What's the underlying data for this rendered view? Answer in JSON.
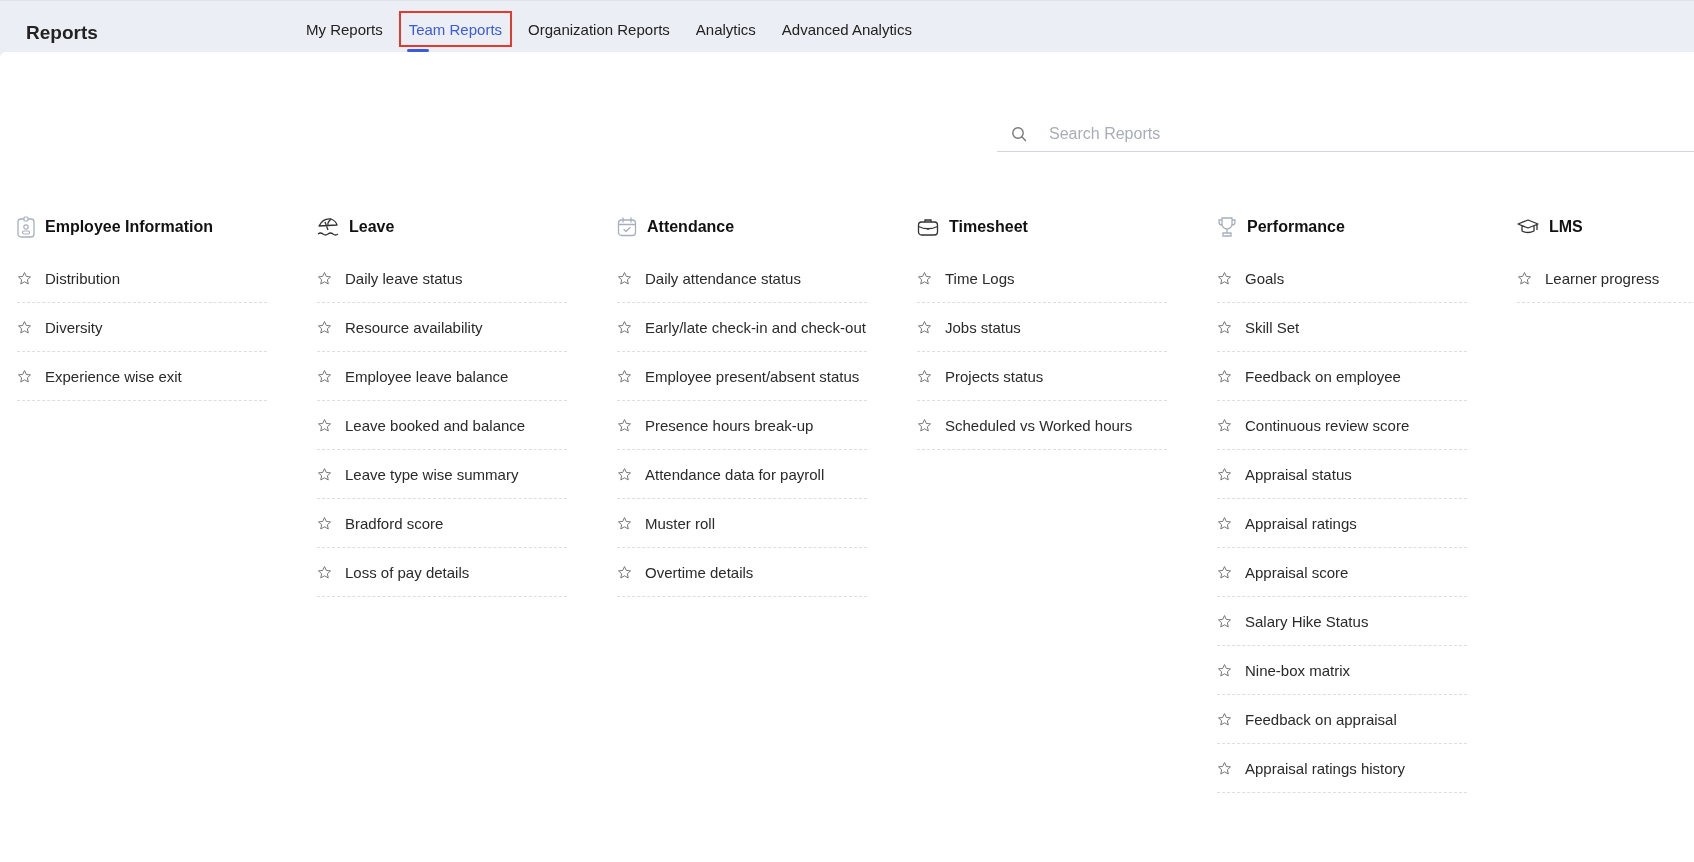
{
  "header": {
    "title": "Reports"
  },
  "tabs": [
    {
      "label": "My Reports",
      "selected": false,
      "highlighted": false
    },
    {
      "label": "Team Reports",
      "selected": true,
      "highlighted": true
    },
    {
      "label": "Organization Reports",
      "selected": false,
      "highlighted": false
    },
    {
      "label": "Analytics",
      "selected": false,
      "highlighted": false
    },
    {
      "label": "Advanced Analytics",
      "selected": false,
      "highlighted": false
    }
  ],
  "search": {
    "placeholder": "Search Reports"
  },
  "categories": [
    {
      "kind": "badge",
      "title": "Employee Information",
      "reports": [
        {
          "name": "Distribution",
          "starred": false
        },
        {
          "name": "Diversity",
          "starred": false
        },
        {
          "name": "Experience wise exit",
          "starred": false
        }
      ]
    },
    {
      "kind": "umbrella",
      "title": "Leave",
      "reports": [
        {
          "name": "Daily leave status",
          "starred": false
        },
        {
          "name": "Resource availability",
          "starred": false
        },
        {
          "name": "Employee leave balance",
          "starred": false
        },
        {
          "name": "Leave booked and balance",
          "starred": false
        },
        {
          "name": "Leave type wise summary",
          "starred": false
        },
        {
          "name": "Bradford score",
          "starred": false
        },
        {
          "name": "Loss of pay details",
          "starred": false
        }
      ]
    },
    {
      "kind": "calendar",
      "title": "Attendance",
      "reports": [
        {
          "name": "Daily attendance status",
          "starred": false
        },
        {
          "name": "Early/late check-in and check-out",
          "starred": false
        },
        {
          "name": "Employee present/absent status",
          "starred": false
        },
        {
          "name": "Presence hours break-up",
          "starred": false
        },
        {
          "name": "Attendance data for payroll",
          "starred": false
        },
        {
          "name": "Muster roll",
          "starred": false
        },
        {
          "name": "Overtime details",
          "starred": false
        }
      ]
    },
    {
      "kind": "briefcase",
      "title": "Timesheet",
      "reports": [
        {
          "name": "Time Logs",
          "starred": false
        },
        {
          "name": "Jobs status",
          "starred": false
        },
        {
          "name": "Projects status",
          "starred": false
        },
        {
          "name": "Scheduled vs Worked hours",
          "starred": false
        }
      ]
    },
    {
      "kind": "trophy",
      "title": "Performance",
      "reports": [
        {
          "name": "Goals",
          "starred": false
        },
        {
          "name": "Skill Set",
          "starred": false
        },
        {
          "name": "Feedback on employee",
          "starred": false
        },
        {
          "name": "Continuous review score",
          "starred": false
        },
        {
          "name": "Appraisal status",
          "starred": false
        },
        {
          "name": "Appraisal ratings",
          "starred": false
        },
        {
          "name": "Appraisal score",
          "starred": false
        },
        {
          "name": "Salary Hike Status",
          "starred": false
        },
        {
          "name": "Nine-box matrix",
          "starred": false
        },
        {
          "name": "Feedback on appraisal",
          "starred": false
        },
        {
          "name": "Appraisal ratings history",
          "starred": false
        }
      ]
    },
    {
      "kind": "cap",
      "title": "LMS",
      "reports": [
        {
          "name": "Learner progress",
          "starred": false
        }
      ]
    }
  ]
}
